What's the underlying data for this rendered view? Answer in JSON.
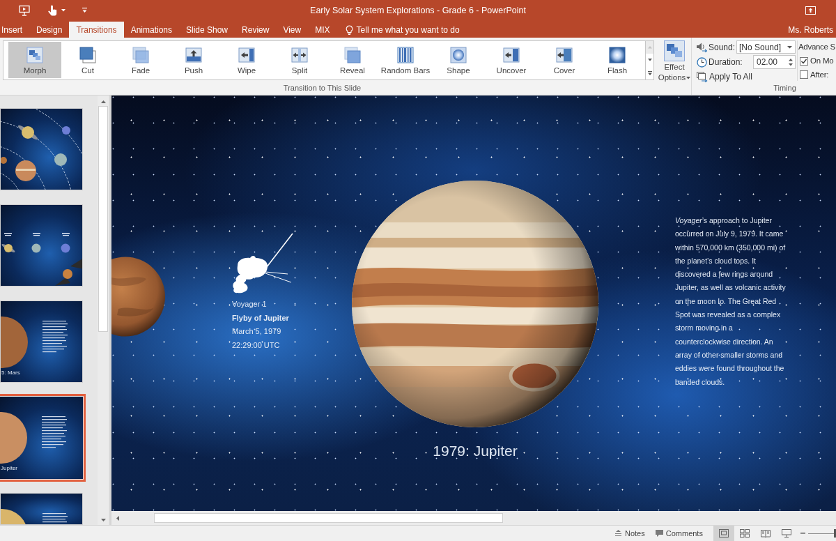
{
  "window": {
    "title": "Early Solar System Explorations - Grade 6 - PowerPoint"
  },
  "tabs": [
    {
      "label": "Insert",
      "selected": false
    },
    {
      "label": "Design",
      "selected": false
    },
    {
      "label": "Transitions",
      "selected": true
    },
    {
      "label": "Animations",
      "selected": false
    },
    {
      "label": "Slide Show",
      "selected": false
    },
    {
      "label": "Review",
      "selected": false
    },
    {
      "label": "View",
      "selected": false
    },
    {
      "label": "MIX",
      "selected": false
    }
  ],
  "tell_me": {
    "label": "Tell me what you want to do"
  },
  "account": {
    "name": "Ms. Roberts"
  },
  "transition_gallery": {
    "items": [
      {
        "kind": "morph",
        "label": "Morph",
        "selected": true
      },
      {
        "kind": "cut",
        "label": "Cut",
        "selected": false
      },
      {
        "kind": "fade",
        "label": "Fade",
        "selected": false
      },
      {
        "kind": "push",
        "label": "Push",
        "selected": false
      },
      {
        "kind": "wipe",
        "label": "Wipe",
        "selected": false
      },
      {
        "kind": "split",
        "label": "Split",
        "selected": false
      },
      {
        "kind": "reveal",
        "label": "Reveal",
        "selected": false
      },
      {
        "kind": "bars",
        "label": "Random Bars",
        "selected": false
      },
      {
        "kind": "shape",
        "label": "Shape",
        "selected": false
      },
      {
        "kind": "uncover",
        "label": "Uncover",
        "selected": false
      },
      {
        "kind": "cover",
        "label": "Cover",
        "selected": false
      },
      {
        "kind": "flash",
        "label": "Flash",
        "selected": false
      }
    ],
    "scroll_buttons": [
      {
        "kind": "up",
        "disabled": true
      },
      {
        "kind": "down",
        "disabled": false
      },
      {
        "kind": "more",
        "disabled": false
      }
    ],
    "group_label": "Transition to This Slide"
  },
  "effect_options": {
    "label": "Effect Options"
  },
  "timing": {
    "sound": {
      "label": "Sound:",
      "value": "[No Sound]"
    },
    "duration": {
      "label": "Duration:",
      "value": "02.00"
    },
    "apply_to_all": "Apply To All",
    "advance_label": "Advance S",
    "advance_options": [
      {
        "label": "On Mo",
        "checked": true
      },
      {
        "label": "After:",
        "checked": false
      }
    ],
    "group_label": "Timing"
  },
  "thumbnails": [
    {
      "kind": "orbits",
      "selected": false
    },
    {
      "kind": "lineup",
      "selected": false
    },
    {
      "kind": "planet",
      "color": "#a2653a",
      "caption": "5: Mars",
      "selected": false
    },
    {
      "kind": "planet",
      "color": "#c98f62",
      "caption": "Jupiter",
      "selected": true
    },
    {
      "kind": "planet",
      "color": "#d9b56a",
      "selected": false
    }
  ],
  "slide": {
    "spacecraft_name": "Voyager 1",
    "event": "Flyby of Jupiter",
    "date": "March 5, 1979",
    "time": "22:29:00 UTC",
    "caption": "1979: Jupiter",
    "description": "*Voyager*’s approach to Jupiter occurred on July 9, 1979. It came within 570,000 km (350,000 mi) of the planet’s cloud tops. It discovered a few rings around Jupiter, as well as volcanic activity on the moon Io. The Great Red Spot was revealed as a complex storm moving in a counterclockwise direction. An array of other smaller storms and eddies were found throughout the banded clouds."
  },
  "status_bar": {
    "notes": "Notes",
    "comments": "Comments",
    "views": [
      {
        "kind": "normal",
        "selected": true
      },
      {
        "kind": "sorter",
        "selected": false
      },
      {
        "kind": "reading",
        "selected": false
      },
      {
        "kind": "slideshow",
        "selected": false
      }
    ],
    "zoom": {
      "level": 0.37
    }
  }
}
